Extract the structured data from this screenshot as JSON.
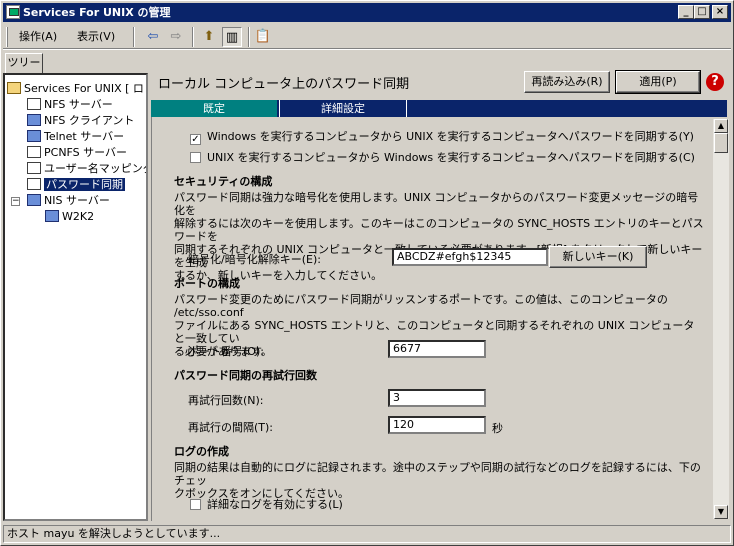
{
  "window": {
    "title": "Services For UNIX の管理",
    "min_glyph": "_",
    "max_glyph": "□",
    "close_glyph": "×"
  },
  "menu": {
    "action": "操作(A)",
    "view": "表示(V)"
  },
  "toolbar": {
    "back_glyph": "⇦",
    "forward_glyph": "⇨",
    "up_glyph": "⬆",
    "toggle_glyph": "▥",
    "export_glyph": "📋"
  },
  "tree": {
    "tab_label": "ツリー",
    "root": "Services For UNIX [ ロ",
    "items": [
      "NFS サーバー",
      "NFS クライアント",
      "Telnet サーバー",
      "PCNFS サーバー",
      "ユーザー名マッピング",
      "パスワード同期",
      "NIS サーバー"
    ],
    "subitem": "W2K2"
  },
  "main": {
    "title": "ローカル コンピュータ上のパスワード同期",
    "reload_label": "再読み込み(R)",
    "apply_label": "適用(P)",
    "help_glyph": "?",
    "tabs": [
      "既定",
      "詳細設定"
    ]
  },
  "sync": {
    "win_to_unix": "Windows を実行するコンピュータから UNIX を実行するコンピュータへパスワードを同期する(Y)",
    "unix_to_win": "UNIX を実行するコンピュータから Windows を実行するコンピュータへパスワードを同期する(C)",
    "win_to_unix_checked": "✓"
  },
  "security": {
    "heading": "セキュリティの構成",
    "desc1": "パスワード同期は強力な暗号化を使用します。UNIX コンピュータからのパスワード変更メッセージの暗号化を",
    "desc2": "解除するには次のキーを使用します。このキーはこのコンピュータの SYNC_HOSTS エントリのキーとパスワードを",
    "desc3": "同期するそれぞれの UNIX コンピュータと一致している必要があります。[新規] をクリックして新しいキーを生成",
    "desc4": "するか、新しいキーを入力してください。",
    "key_label": "暗号化/暗号化解除キー(E):",
    "key_value": "ABCDZ#efgh$12345",
    "newkey_label": "新しいキー(K)"
  },
  "port": {
    "heading": "ポートの構成",
    "desc1": "パスワード変更のためにパスワード同期がリッスンするポートです。この値は、このコンピュータの /etc/sso.conf",
    "desc2": "ファイルにある SYNC_HOSTS エントリと、このコンピュータと同期するそれぞれの UNIX コンピュータと一致してい",
    "desc3": "る必要があります。",
    "port_label": "ポート番号(O):",
    "port_value": "6677"
  },
  "retry": {
    "heading": "パスワード同期の再試行回数",
    "count_label": "再試行回数(N):",
    "count_value": "3",
    "interval_label": "再試行の間隔(T):",
    "interval_value": "120",
    "unit": "秒"
  },
  "logging": {
    "heading": "ログの作成",
    "desc1": "同期の結果は自動的にログに記録されます。途中のステップや同期の試行などのログを記録するには、下のチェッ",
    "desc2": "クボックスをオンにしてください。",
    "verbose_label": "詳細なログを有効にする(L)"
  },
  "status": {
    "text": "ホスト mayu を解決しようとしています..."
  }
}
